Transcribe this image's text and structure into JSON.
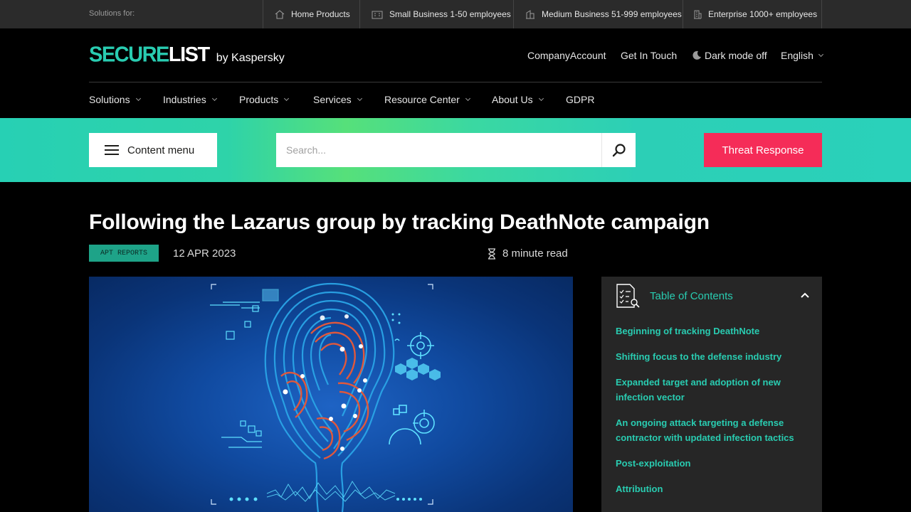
{
  "topbar": {
    "label": "Solutions for:",
    "items": [
      {
        "icon": "home-icon",
        "label": "Home Products"
      },
      {
        "icon": "small-building-icon",
        "label": "Small Business 1-50 employees"
      },
      {
        "icon": "medium-building-icon",
        "label": "Medium Business 51-999 employees"
      },
      {
        "icon": "enterprise-building-icon",
        "label": "Enterprise 1000+ employees"
      }
    ]
  },
  "header": {
    "logo_secure": "SECURE",
    "logo_list": "LIST",
    "logo_by": "by Kaspersky",
    "company_account": "CompanyAccount",
    "get_in_touch": "Get In Touch",
    "dark_mode": "Dark mode off",
    "language": "English"
  },
  "nav": {
    "items": [
      {
        "label": "Solutions",
        "dropdown": true
      },
      {
        "label": "Industries",
        "dropdown": true
      },
      {
        "label": "Products",
        "dropdown": true
      },
      {
        "label": "Services",
        "dropdown": true
      },
      {
        "label": "Resource Center",
        "dropdown": true
      },
      {
        "label": "About Us",
        "dropdown": true
      },
      {
        "label": "GDPR",
        "dropdown": false
      }
    ]
  },
  "band": {
    "content_menu": "Content menu",
    "search_placeholder": "Search...",
    "threat_response": "Threat Response"
  },
  "article": {
    "title": "Following the Lazarus group by tracking DeathNote campaign",
    "tag": "APT REPORTS",
    "date": "12 APR 2023",
    "read_time": "8 minute read"
  },
  "toc": {
    "title": "Table of Contents",
    "items": [
      "Beginning of tracking DeathNote",
      "Shifting focus to the defense industry",
      "Expanded target and adoption of new infection vector",
      "An ongoing attack targeting a defense contractor with updated infection tactics",
      "Post-exploitation",
      "Attribution"
    ]
  },
  "colors": {
    "accent": "#29ccb1",
    "threat": "#f52c58",
    "band_start": "#27d0b4",
    "band_glow": "#56e07a"
  }
}
